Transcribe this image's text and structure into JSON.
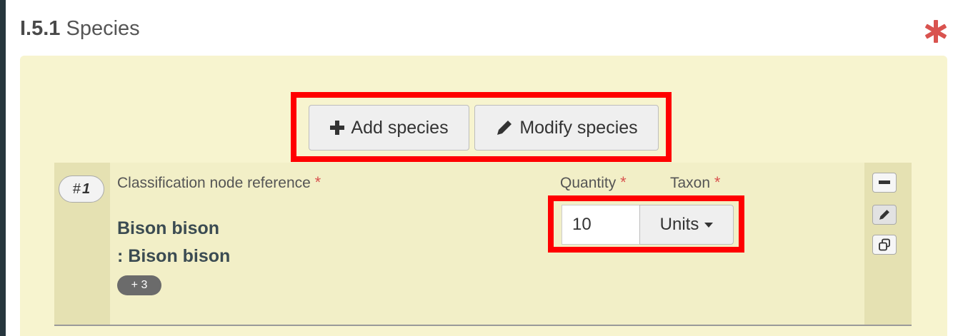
{
  "section": {
    "code": "I.5.1",
    "title": "Species"
  },
  "toolbar": {
    "add_label": "Add species",
    "modify_label": "Modify species"
  },
  "row": {
    "index_prefix": "#",
    "index": "1",
    "labels": {
      "classification": "Classification node reference",
      "quantity": "Quantity",
      "taxon": "Taxon"
    },
    "required_mark": "*",
    "species_name": "Bison bison",
    "species_sub": ": Bison bison",
    "extra_count": "+ 3",
    "quantity_value": "10",
    "unit": "Units"
  },
  "icons": {
    "required": "asterisk-icon",
    "add": "plus-icon",
    "modify": "pencil-icon",
    "remove": "minus-icon",
    "edit": "pencil-icon",
    "copy": "copy-icon",
    "dropdown": "caret-down-icon"
  },
  "colors": {
    "required": "#d9534f",
    "highlight": "#ff0000",
    "panel": "#f7f4cf",
    "row_side": "#e5e1b2"
  }
}
